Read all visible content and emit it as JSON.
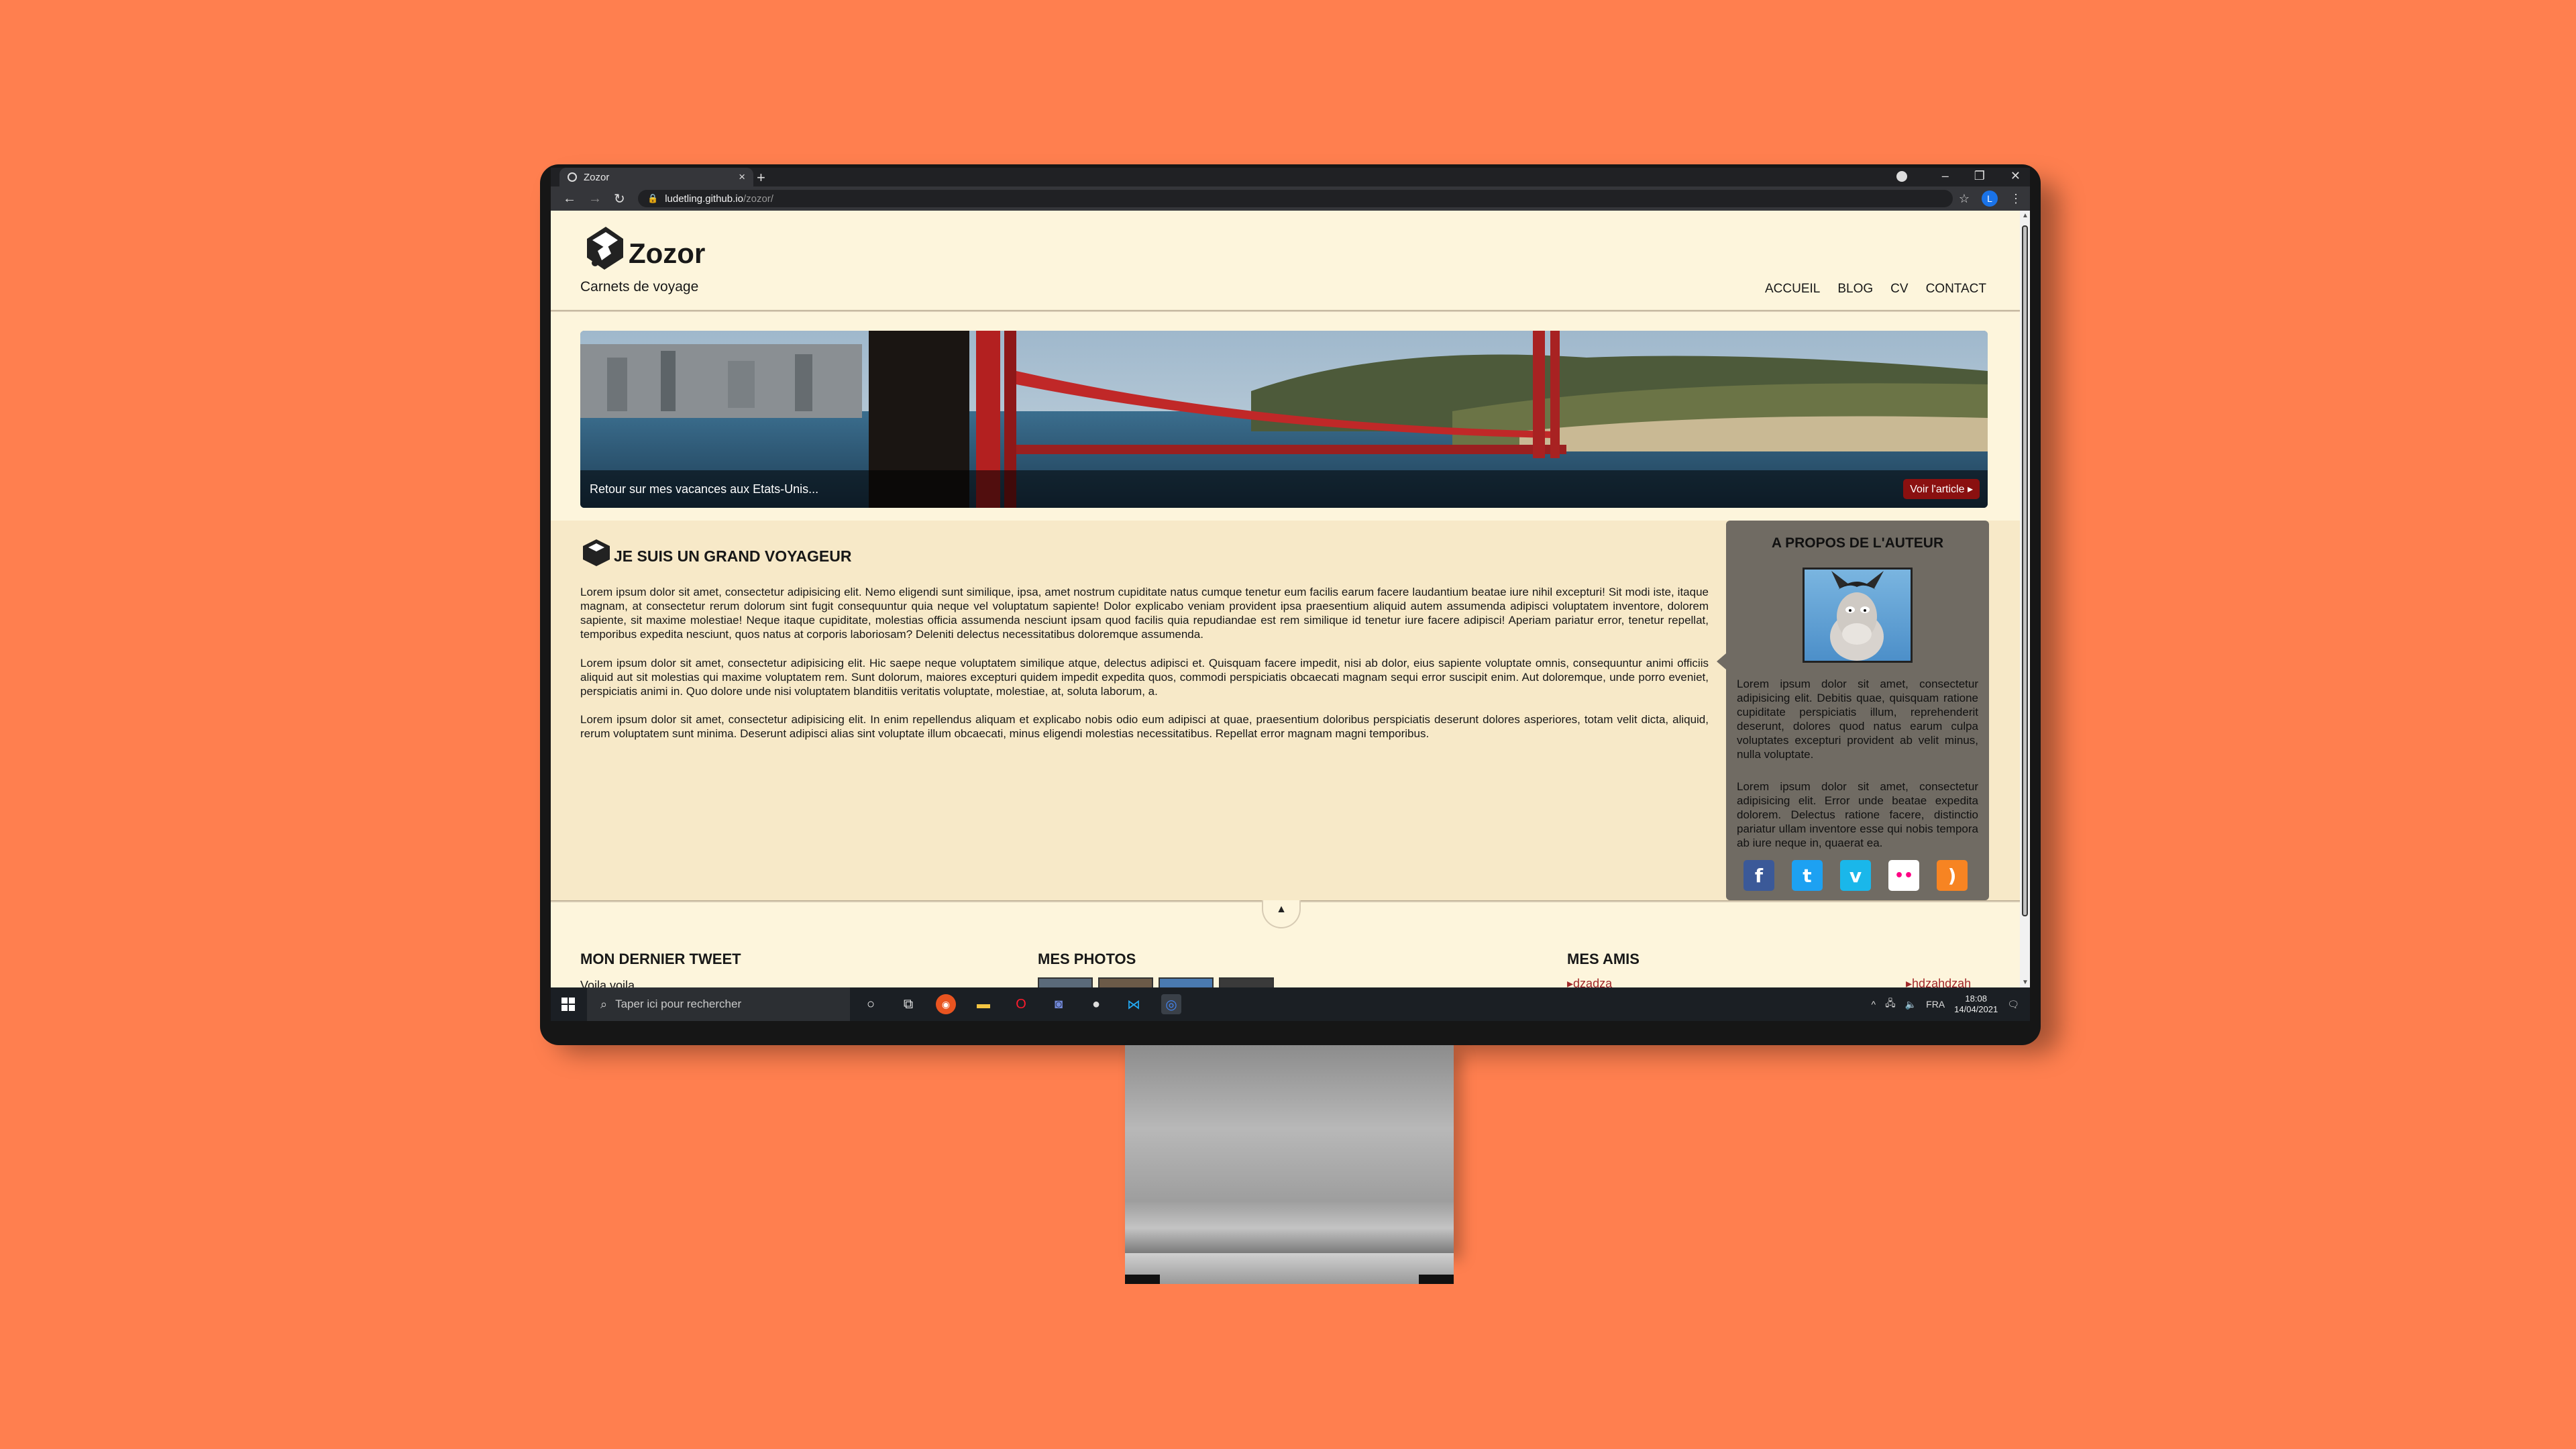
{
  "browser": {
    "tab_title": "Zozor",
    "url_host": "ludetling.github.io",
    "url_path": "/zozor/",
    "profile_initial": "L"
  },
  "site": {
    "logo_text": "Zozor",
    "tagline": "Carnets de voyage",
    "nav": [
      "ACCUEIL",
      "BLOG",
      "CV",
      "CONTACT"
    ]
  },
  "banner": {
    "caption": "Retour sur mes vacances aux Etats-Unis...",
    "button": "Voir l'article"
  },
  "article": {
    "title": "JE SUIS UN GRAND VOYAGEUR",
    "paragraphs": [
      "Lorem ipsum dolor sit amet, consectetur adipisicing elit. Nemo eligendi sunt similique, ipsa, amet nostrum cupiditate natus cumque tenetur eum facilis earum facere laudantium beatae iure nihil excepturi! Sit modi iste, itaque magnam, at consectetur rerum dolorum sint fugit consequuntur quia neque vel voluptatum sapiente! Dolor explicabo veniam provident ipsa praesentium aliquid autem assumenda adipisci voluptatem inventore, dolorem sapiente, sit maxime molestiae! Neque itaque cupiditate, molestias officia assumenda nesciunt ipsam quod facilis quia repudiandae est rem similique id tenetur iure facere adipisci! Aperiam pariatur error, tenetur repellat, temporibus expedita nesciunt, quos natus at corporis laboriosam? Deleniti delectus necessitatibus doloremque assumenda.",
      "Lorem ipsum dolor sit amet, consectetur adipisicing elit. Hic saepe neque voluptatem similique atque, delectus adipisci et. Quisquam facere impedit, nisi ab dolor, eius sapiente voluptate omnis, consequuntur animi officiis aliquid aut sit molestias qui maxime voluptatem rem. Sunt dolorum, maiores excepturi quidem impedit expedita quos, commodi perspiciatis obcaecati magnam sequi error suscipit enim. Aut doloremque, unde porro eveniet, perspiciatis animi in. Quo dolore unde nisi voluptatem blanditiis veritatis voluptate, molestiae, at, soluta laborum, a.",
      "Lorem ipsum dolor sit amet, consectetur adipisicing elit. In enim repellendus aliquam et explicabo nobis odio eum adipisci at quae, praesentium doloribus perspiciatis deserunt dolores asperiores, totam velit dicta, aliquid, rerum voluptatem sunt minima. Deserunt adipisci alias sint voluptate illum obcaecati, minus eligendi molestias necessitatibus. Repellat error magnam magni temporibus."
    ]
  },
  "aside": {
    "title": "A PROPOS DE L'AUTEUR",
    "paragraphs": [
      "Lorem ipsum dolor sit amet, consectetur adipisicing elit. Debitis quae, quisquam ratione cupiditate perspiciatis illum, reprehenderit deserunt, dolores quod natus earum culpa voluptates excepturi provident ab velit minus, nulla voluptate.",
      "Lorem ipsum dolor sit amet, consectetur adipisicing elit. Error unde beatae expedita dolorem. Delectus ratione facere, distinctio pariatur ullam inventore esse qui nobis tempora ab iure neque in, quaerat ea."
    ],
    "socials": [
      {
        "icon": "facebook-icon",
        "glyph": "f",
        "color": "#3b5998"
      },
      {
        "icon": "twitter-icon",
        "glyph": "t",
        "color": "#1da1f2"
      },
      {
        "icon": "vimeo-icon",
        "glyph": "v",
        "color": "#1ab7ea"
      },
      {
        "icon": "flickr-icon",
        "glyph": "••",
        "color": "#ffffff"
      },
      {
        "icon": "rss-icon",
        "glyph": ")",
        "color": "#f78422"
      }
    ]
  },
  "footer": {
    "tweet_title": "MON DERNIER TWEET",
    "tweet_text": "Voila voila",
    "photos_title": "MES PHOTOS",
    "friends_title": "MES AMIS",
    "friends": [
      "dzadza",
      "hdzahdzah"
    ]
  },
  "taskbar": {
    "search_placeholder": "Taper ici pour rechercher",
    "lang": "FRA",
    "time": "18:08",
    "date": "14/04/2021"
  }
}
